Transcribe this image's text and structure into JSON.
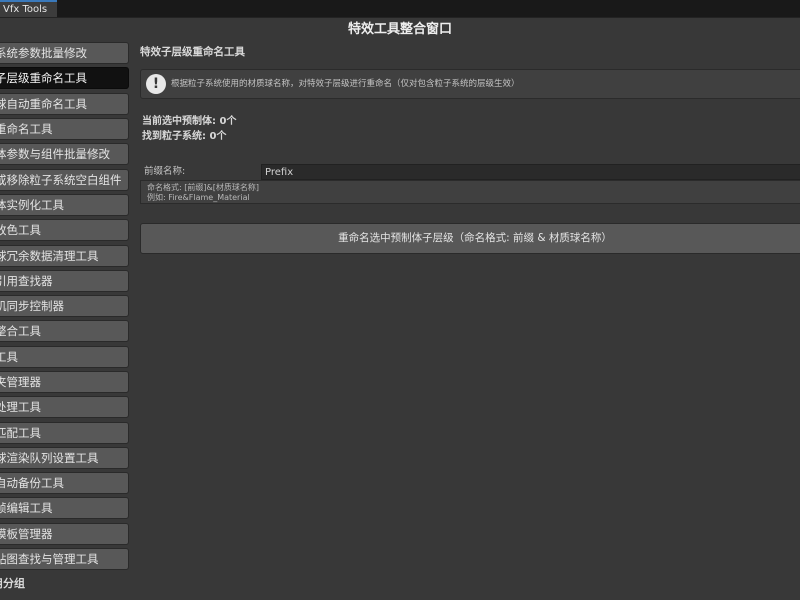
{
  "tab": {
    "label": "Vfx Tools"
  },
  "window": {
    "title": "特效工具整合窗口"
  },
  "sidebar": {
    "items": [
      {
        "label": "系统参数批量修改",
        "top": 0,
        "selected": false
      },
      {
        "label": "子层级重命名工具",
        "selected": true
      },
      {
        "label": "球自动重命名工具",
        "selected": false
      },
      {
        "label": "重命名工具",
        "selected": false
      },
      {
        "label": "体参数与组件批量修改",
        "selected": false
      },
      {
        "label": "或移除粒子系统空白组件",
        "selected": false
      },
      {
        "label": "体实例化工具",
        "selected": false
      },
      {
        "label": "改色工具",
        "selected": false
      },
      {
        "label": "球冗余数据清理工具",
        "selected": false
      },
      {
        "label": "引用查找器",
        "selected": false
      },
      {
        "label": "机同步控制器",
        "selected": false
      },
      {
        "label": "整合工具",
        "selected": false
      },
      {
        "label": "工具",
        "selected": false
      },
      {
        "label": "夹管理器",
        "selected": false
      },
      {
        "label": "处理工具",
        "selected": false
      },
      {
        "label": "匹配工具",
        "selected": false
      },
      {
        "label": "球渲染队列设置工具",
        "selected": false
      },
      {
        "label": "自动备份工具",
        "selected": false
      },
      {
        "label": "帧编辑工具",
        "selected": false
      },
      {
        "label": "模板管理器",
        "selected": false
      },
      {
        "label": "贴图查找与管理工具",
        "selected": false
      }
    ],
    "group_label": "用分组"
  },
  "main": {
    "section_title": "特效子层级重命名工具",
    "help": {
      "icon": "exclamation-icon",
      "text": "根据粒子系统使用的材质球名称，对特效子层级进行重命名（仅对包含粒子系统的层级生效）"
    },
    "info": {
      "selected_prefabs": "当前选中预制体: 0个",
      "found_particles": "找到粒子系统: 0个"
    },
    "prefix": {
      "label": "前缀名称:",
      "value": "Prefix"
    },
    "format": {
      "line1": "命名格式: [前缀]&[材质球名称]",
      "line2": "例如: Fire&Flame_Material"
    },
    "action_button": "重命名选中预制体子层级（命名格式: 前缀 & 材质球名称）"
  }
}
